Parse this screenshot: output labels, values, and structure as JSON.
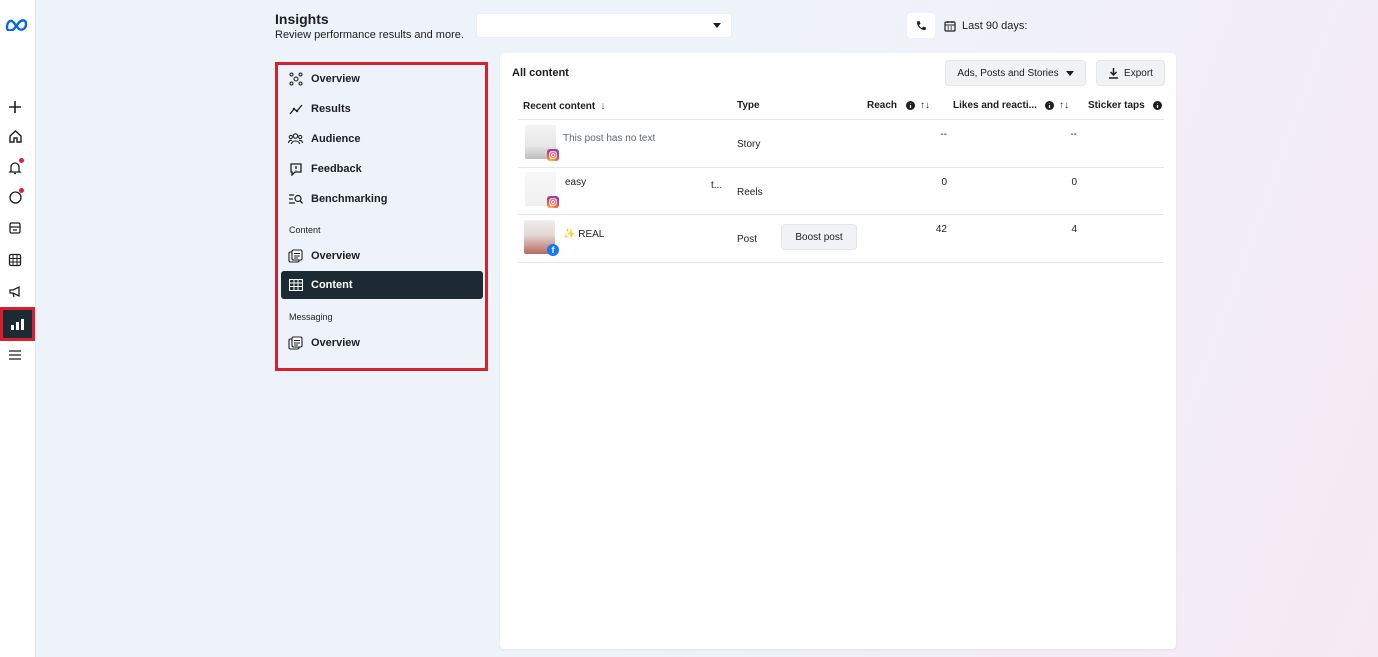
{
  "rail": {
    "icons": [
      "meta-logo-icon",
      "plus-icon",
      "home-icon",
      "notifications-icon",
      "messages-icon",
      "pages-icon",
      "table-icon",
      "megaphone-icon",
      "insights-icon",
      "menu-icon"
    ]
  },
  "header": {
    "title": "Insights",
    "subtitle": "Review performance results and more.",
    "account_select_value": "",
    "date_range": "Last 90 days:"
  },
  "nav": {
    "items_main": [
      {
        "label": "Overview",
        "icon": "overview-icon"
      },
      {
        "label": "Results",
        "icon": "results-icon"
      },
      {
        "label": "Audience",
        "icon": "audience-icon"
      },
      {
        "label": "Feedback",
        "icon": "feedback-icon"
      },
      {
        "label": "Benchmarking",
        "icon": "benchmarking-icon"
      }
    ],
    "section_content": "Content",
    "items_content": [
      {
        "label": "Overview",
        "icon": "content-overview-icon"
      },
      {
        "label": "Content",
        "icon": "content-grid-icon",
        "active": true
      }
    ],
    "section_messaging": "Messaging",
    "items_messaging": [
      {
        "label": "Overview",
        "icon": "messaging-overview-icon"
      }
    ]
  },
  "panel": {
    "title": "All content",
    "filter_label": "Ads, Posts and Stories",
    "export_label": "Export",
    "columns": [
      "Recent content",
      "Type",
      "Reach",
      "Likes and reacti...",
      "Sticker taps"
    ],
    "sort_arrow": "↓",
    "sort_toggle": "↑↓",
    "rows": [
      {
        "text": "This post has no text",
        "text_extra": "",
        "platform": "instagram",
        "type": "Story",
        "reach": "--",
        "likes": "--",
        "boost": ""
      },
      {
        "text": "easy",
        "text_extra": "t...",
        "platform": "instagram",
        "type": "Reels",
        "reach": "0",
        "likes": "0",
        "boost": ""
      },
      {
        "text": "✨ REAL",
        "text_extra": "",
        "platform": "facebook",
        "type": "Post",
        "reach": "42",
        "likes": "4",
        "boost": "Boost post"
      }
    ]
  },
  "colors": {
    "highlight_red": "#d6202e",
    "active_nav": "#1c2b33",
    "meta_blue": "#0668e1"
  }
}
